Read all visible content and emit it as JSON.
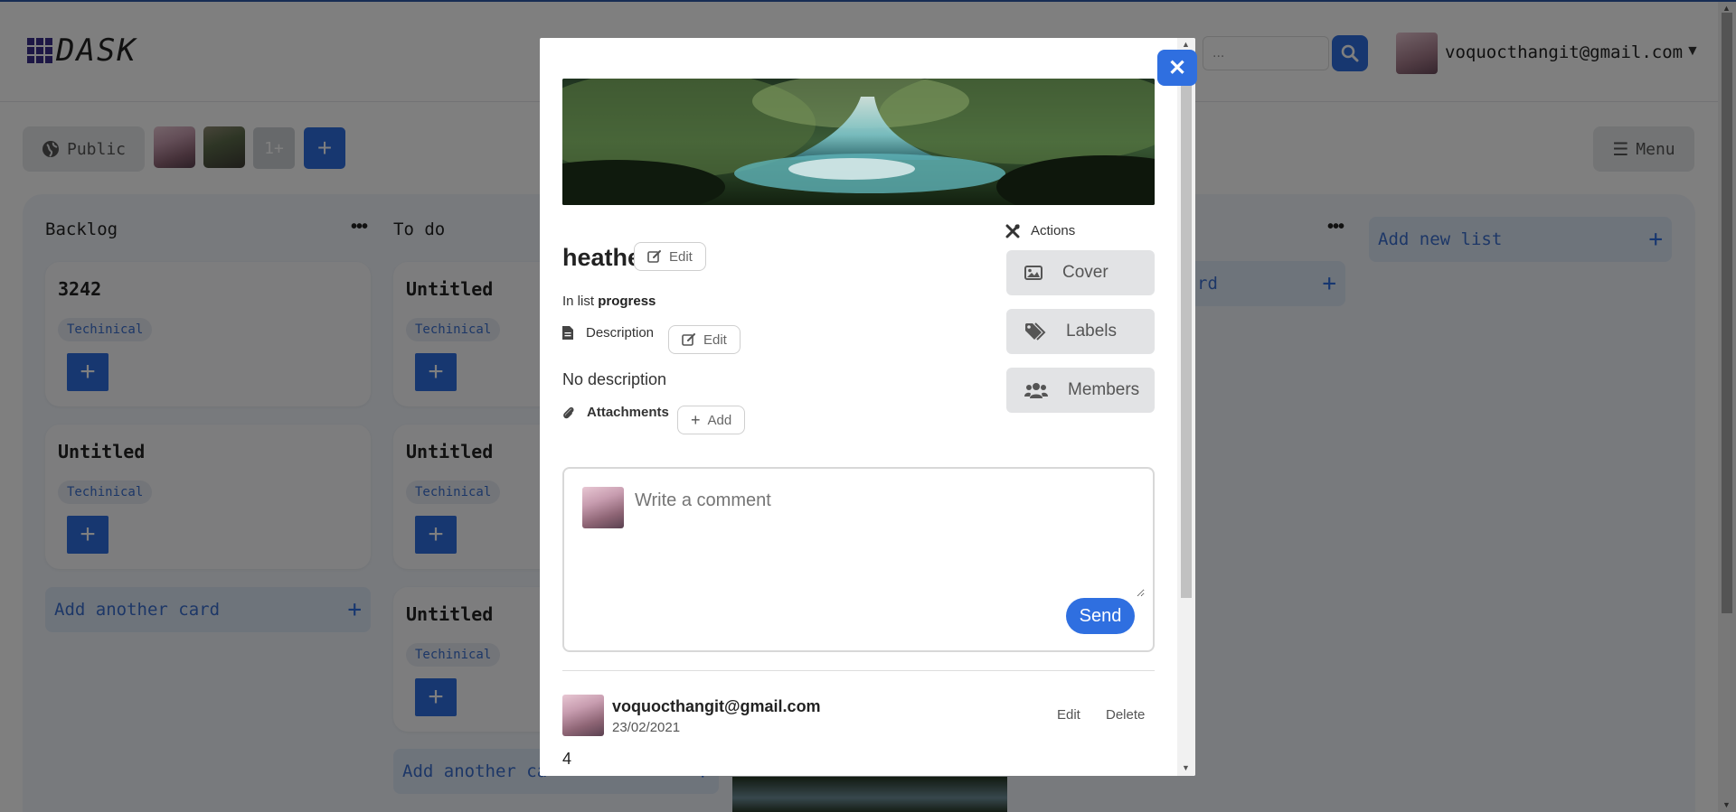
{
  "app": {
    "logo_text": "DASK"
  },
  "header": {
    "search_placeholder": "...",
    "user_email": "voquocthangit@gmail.com"
  },
  "toolbar": {
    "visibility_label": "Public",
    "members_more": "1+",
    "add_member_icon": "plus-icon",
    "menu_label": "Menu"
  },
  "board": {
    "lists": [
      {
        "title": "Backlog",
        "cards": [
          {
            "title": "3242",
            "label": "Techinical"
          },
          {
            "title": "Untitled",
            "label": "Techinical"
          }
        ],
        "add_card_label": "Add another card"
      },
      {
        "title": "To do",
        "cards": [
          {
            "title": "Untitled",
            "label": "Techinical"
          },
          {
            "title": "Untitled",
            "label": "Techinical"
          },
          {
            "title": "Untitled",
            "label": "Techinical"
          }
        ],
        "add_card_label": "Add another ca"
      },
      {
        "title": "",
        "add_card_label": "rd"
      }
    ],
    "add_list_label": "Add new list"
  },
  "modal": {
    "card_name": "heather",
    "edit_label": "Edit",
    "in_list_prefix": "In list",
    "in_list_name": "progress",
    "description_label": "Description",
    "no_description": "No description",
    "attachments_label": "Attachments",
    "add_label": "Add",
    "actions_label": "Actions",
    "actions": [
      {
        "label": "Cover",
        "icon": "image-icon"
      },
      {
        "label": "Labels",
        "icon": "tags-icon"
      },
      {
        "label": "Members",
        "icon": "users-icon"
      }
    ],
    "comment_placeholder": "Write a comment",
    "send_label": "Send",
    "comments": [
      {
        "author": "voquocthangit@gmail.com",
        "date": "23/02/2021",
        "text": "4",
        "edit_label": "Edit",
        "delete_label": "Delete"
      }
    ]
  },
  "colors": {
    "primary": "#2f6fe0",
    "label_bg": "#e6eaf2",
    "label_text": "#3a6fcf",
    "overlay": "rgba(0,0,0,0.5)"
  }
}
